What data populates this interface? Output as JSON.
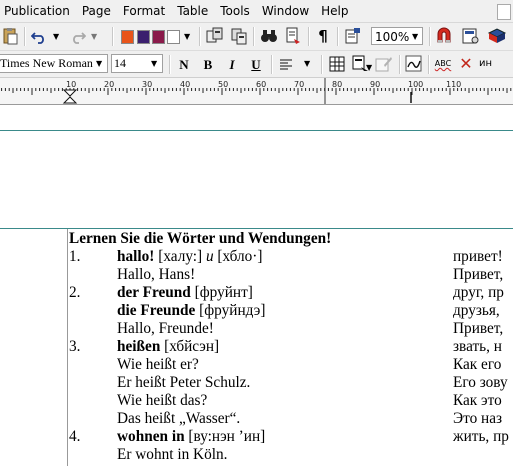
{
  "menu": [
    "Publication",
    "Page",
    "Format",
    "Table",
    "Tools",
    "Window",
    "Help"
  ],
  "toolbar": {
    "zoom": "100%",
    "colors": [
      "#e8541a",
      "#3a1f6e",
      "#8a1a4a",
      "#ffffff"
    ]
  },
  "format_bar": {
    "font_name": "Times New Roman",
    "font_size": "14",
    "bold": "B",
    "italic": "I",
    "underline": "U",
    "normal": "N",
    "spell": "ABC",
    "lang_hint": "ин"
  },
  "ruler": {
    "labels": [
      "10",
      "20",
      "30",
      "40",
      "50",
      "60",
      "70",
      "80",
      "90",
      "100",
      "110"
    ]
  },
  "document": {
    "heading": "Lernen Sie die Wörter und Wendungen!",
    "rows": [
      {
        "num": "1.",
        "de_bold": "hallo!",
        "de_rest": " [халу:] ",
        "de_italic": "и",
        "de_after": " [хбло·]",
        "ru": "привет!"
      },
      {
        "num": "",
        "de_bold": "",
        "de_rest": "Hallo, Hans!",
        "de_italic": "",
        "de_after": "",
        "ru": "Привет,"
      },
      {
        "num": "2.",
        "de_bold": "der Freund",
        "de_rest": " [фруйнт]",
        "de_italic": "",
        "de_after": "",
        "ru": "друг, пр"
      },
      {
        "num": "",
        "de_bold": "die Freunde",
        "de_rest": " [фруйндэ]",
        "de_italic": "",
        "de_after": "",
        "ru": "друзья,"
      },
      {
        "num": "",
        "de_bold": "",
        "de_rest": "Hallo, Freunde!",
        "de_italic": "",
        "de_after": "",
        "ru": "Привет,"
      },
      {
        "num": "3.",
        "de_bold": "heißen",
        "de_rest": " [хбйсэн]",
        "de_italic": "",
        "de_after": "",
        "ru": "звать, н"
      },
      {
        "num": "",
        "de_bold": "",
        "de_rest": "Wie heißt er?",
        "de_italic": "",
        "de_after": "",
        "ru": "Как его"
      },
      {
        "num": "",
        "de_bold": "",
        "de_rest": "Er heißt Peter Schulz.",
        "de_italic": "",
        "de_after": "",
        "ru": "Его зову"
      },
      {
        "num": "",
        "de_bold": "",
        "de_rest": "Wie heißt das?",
        "de_italic": "",
        "de_after": "",
        "ru": "Как это"
      },
      {
        "num": "",
        "de_bold": "",
        "de_rest": "Das heißt „Wasser“.",
        "de_italic": "",
        "de_after": "",
        "ru": "Это наз"
      },
      {
        "num": "4.",
        "de_bold": "wohnen in",
        "de_rest": " [ву:нэн ’ин]",
        "de_italic": "",
        "de_after": "",
        "ru": "жить, пр"
      },
      {
        "num": "",
        "de_bold": "",
        "de_rest": "Er wohnt in Köln.",
        "de_italic": "",
        "de_after": "",
        "ru": ""
      }
    ]
  }
}
